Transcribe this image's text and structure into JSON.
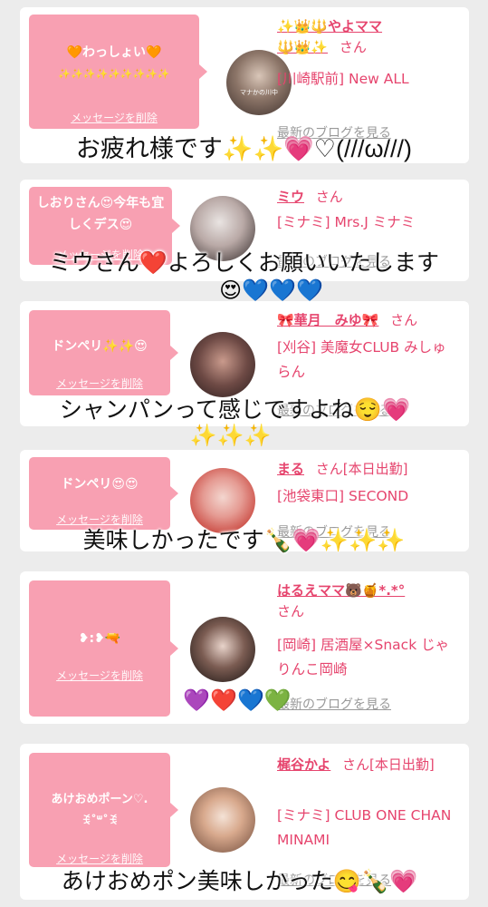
{
  "cards": [
    {
      "bubble_text": "🧡わっしょい🧡",
      "bubble_sub": "✨✨✨✨✨✨✨✨✨",
      "delete_label": "メッセージを削除",
      "name_prefix": "✨👑🔱やよママ",
      "name_line2": "🔱👑✨",
      "san": "さん",
      "shop": "[川崎駅前] New ALL",
      "blog_label": "最新のブログを見る",
      "avatar_caption": "マナかの川中"
    },
    {
      "bubble_text": "しおりさん😍今年も宜しくデス😍",
      "delete_label": "メッセージを削除",
      "name": "ミウ",
      "san": "さん",
      "shop": "[ミナミ] Mrs.J ミナミ",
      "blog_label": "最新のブログを見る"
    },
    {
      "bubble_text": "ドンペリ✨✨😍",
      "delete_label": "メッセージを削除",
      "name": "🎀華月　みゆ🎀",
      "san": "さん",
      "shop": "[刈谷] 美魔女CLUB みしゅらん",
      "blog_label": "最新のブログを見る"
    },
    {
      "bubble_text": "ドンペリ😍😍",
      "delete_label": "メッセージを削除",
      "name": "まる",
      "san": "さん[本日出勤]",
      "shop": "[池袋東口] SECOND",
      "blog_label": "最新のブログを見る"
    },
    {
      "bubble_text": "❥:❥🔫",
      "delete_label": "メッセージを削除",
      "name": "はるえママ🐻🍯*.*°",
      "san": "さん",
      "shop": "[岡崎] 居酒屋×Snack じゃりんこ岡崎",
      "blog_label": "最新のブログを見る"
    },
    {
      "bubble_text": "あけおめポーン♡.",
      "bubble_sub": "ꉂ˚ᐜ˚ꉂ",
      "delete_label": "メッセージを削除",
      "name": "梶谷かよ",
      "san": "さん[本日出勤]",
      "shop": "[ミナミ] CLUB ONE CHAN MINAMI",
      "blog_label": "最新のブログを見る"
    }
  ],
  "captions": [
    "お疲れ様です✨✨💗♡(///ω///)",
    "ミウさん❤️よろしくお願いいたします",
    "😍💙💙💙",
    "シャンパンって感じですよね😌💗",
    "✨✨✨",
    "美味しかったです🍾💗✨✨✨",
    "💜❤️💙💚",
    "あけおめポン美味しかった😋🍾💗"
  ]
}
